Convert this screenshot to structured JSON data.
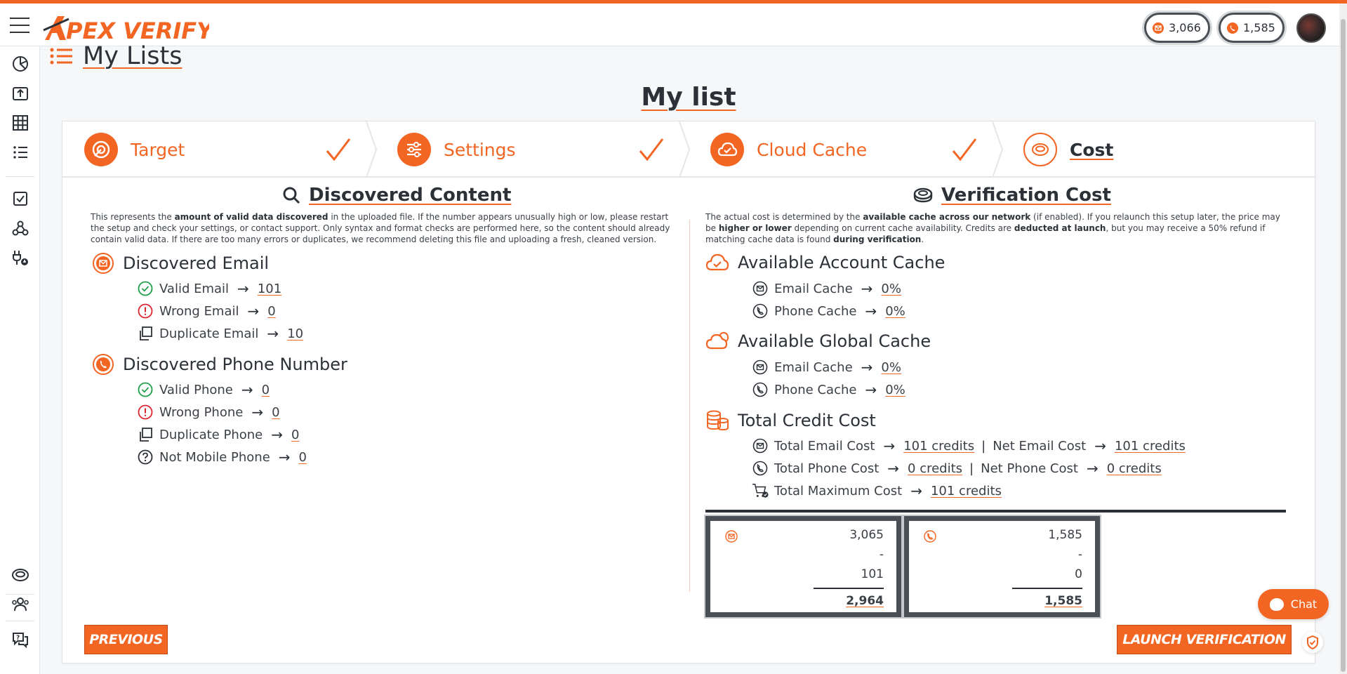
{
  "app": {
    "brand": "APEX VERIFY"
  },
  "topbar": {
    "email_credits": "3,066",
    "phone_credits": "1,585"
  },
  "page": {
    "title": "My Lists",
    "list_title": "My list"
  },
  "steps": [
    {
      "label": "Target",
      "done": true
    },
    {
      "label": "Settings",
      "done": true
    },
    {
      "label": "Cloud Cache",
      "done": true
    },
    {
      "label": "Cost",
      "done": false
    }
  ],
  "discovered": {
    "heading": "Discovered Content",
    "desc_html": "This represents the <b>amount of valid data discovered</b> in the uploaded file. If the number appears unusually high or low, please restart the setup and check your settings, or contact support. Only syntax and format checks are performed here, so the content should already contain valid data. If there are too many errors or duplicates, we recommend deleting this file and uploading a fresh, cleaned version.",
    "email_heading": "Discovered Email",
    "email_rows": [
      {
        "label": "Valid Email",
        "value": "101"
      },
      {
        "label": "Wrong Email",
        "value": "0"
      },
      {
        "label": "Duplicate Email",
        "value": "10"
      }
    ],
    "phone_heading": "Discovered Phone Number",
    "phone_rows": [
      {
        "label": "Valid Phone",
        "value": "0"
      },
      {
        "label": "Wrong Phone",
        "value": "0"
      },
      {
        "label": "Duplicate Phone",
        "value": "0"
      },
      {
        "label": "Not Mobile Phone",
        "value": "0"
      }
    ]
  },
  "cost": {
    "heading": "Verification Cost",
    "desc_html": "The actual cost is determined by the <b>available cache across our network</b> (if enabled). If you relaunch this setup later, the price may be <b>higher or lower</b> depending on current cache availability. Credits are <b>deducted at launch</b>, but you may receive a 50% refund if matching cache data is found <b>during verification</b>.",
    "account_cache_heading": "Available Account Cache",
    "account_cache": [
      {
        "label": "Email Cache",
        "value": "0%"
      },
      {
        "label": "Phone Cache",
        "value": "0%"
      }
    ],
    "global_cache_heading": "Available Global Cache",
    "global_cache": [
      {
        "label": "Email Cache",
        "value": "0%"
      },
      {
        "label": "Phone Cache",
        "value": "0%"
      }
    ],
    "total_heading": "Total Credit Cost",
    "total_email_label": "Total Email Cost",
    "total_email_value": "101 credits",
    "net_email_label": "Net Email Cost",
    "net_email_value": "101 credits",
    "total_phone_label": "Total Phone Cost",
    "total_phone_value": "0 credits",
    "net_phone_label": "Net Phone Cost",
    "net_phone_value": "0 credits",
    "total_max_label": "Total Maximum Cost",
    "total_max_value": "101 credits"
  },
  "calc_email": {
    "balance": "3,065",
    "op": "-",
    "cost": "101",
    "result": "2,964"
  },
  "calc_phone": {
    "balance": "1,585",
    "op": "-",
    "cost": "0",
    "result": "1,585"
  },
  "buttons": {
    "previous": "PREVIOUS",
    "launch": "LAUNCH VERIFICATION",
    "chat": "Chat"
  },
  "colors": {
    "accent": "#f26522",
    "dark": "#2c3138",
    "success": "#1e9e4a",
    "error": "#e0242f"
  }
}
